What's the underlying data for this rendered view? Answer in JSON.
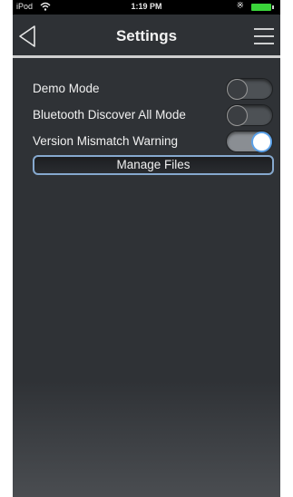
{
  "statusbar": {
    "carrier": "iPod",
    "time": "1:19 PM"
  },
  "navbar": {
    "title": "Settings",
    "back_icon": "back-arrow-icon",
    "menu_icon": "hamburger-menu-icon"
  },
  "settings": {
    "demo_mode": {
      "label": "Demo Mode",
      "enabled": false
    },
    "bluetooth_discover_all": {
      "label": "Bluetooth Discover All Mode",
      "enabled": false
    },
    "version_mismatch_warning": {
      "label": "Version Mismatch Warning",
      "enabled": true
    }
  },
  "manage_files": {
    "label": "Manage Files"
  },
  "colors": {
    "background": "#2f3236",
    "toggle_on_accent": "#5aa0e8",
    "button_border": "#86a9cf"
  }
}
